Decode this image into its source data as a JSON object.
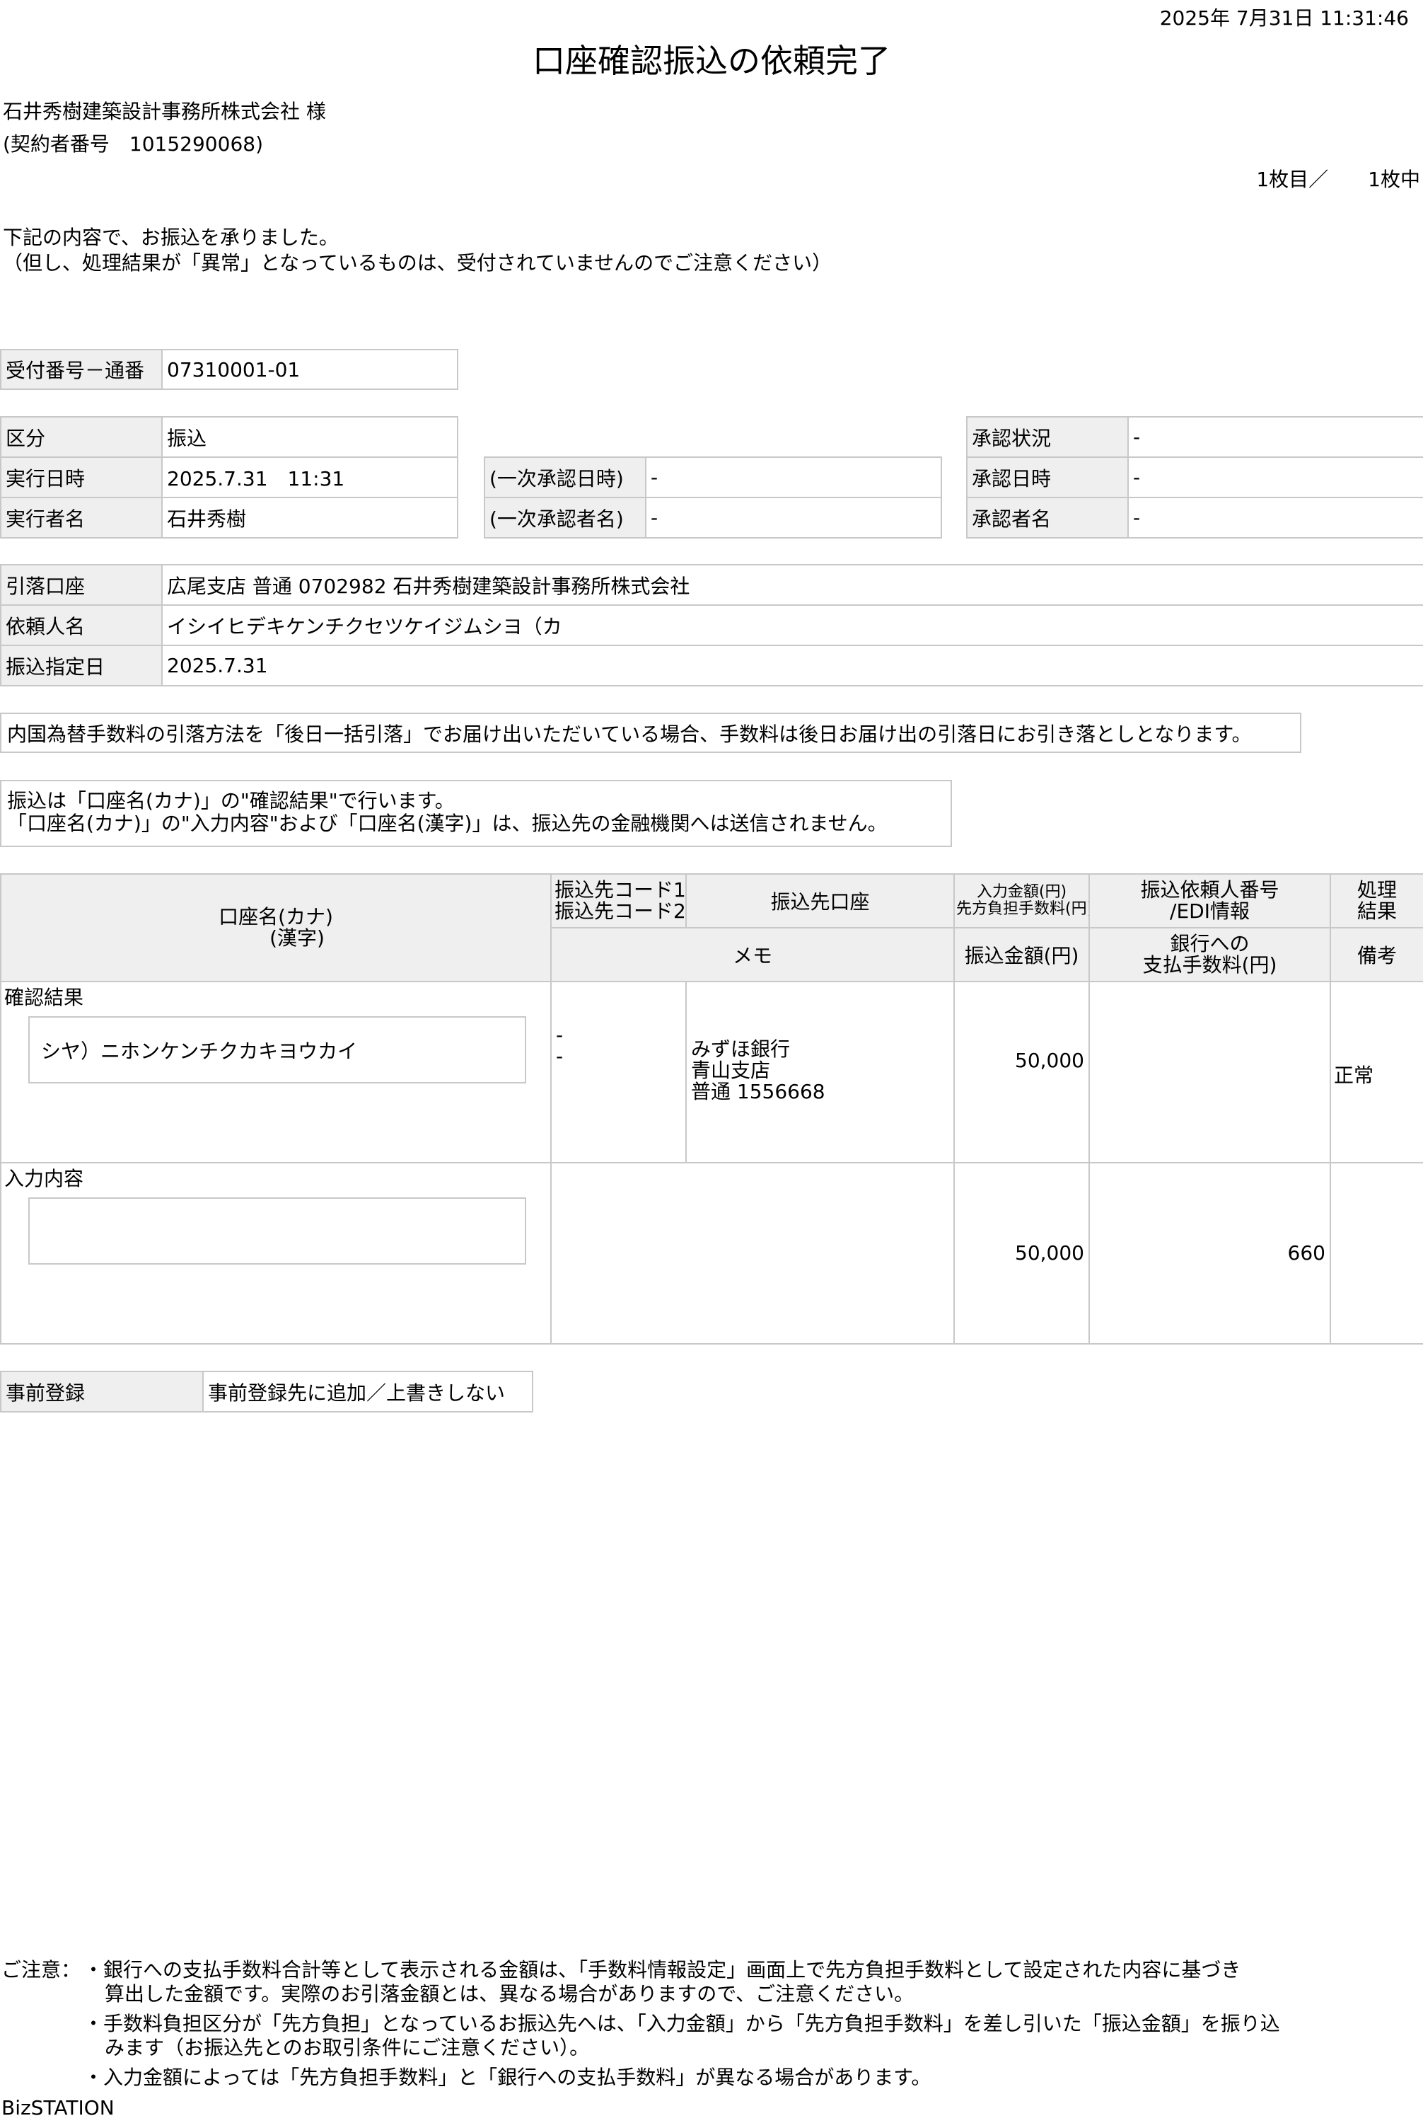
{
  "timestamp": "2025年 7月31日 11:31:46",
  "title": "口座確認振込の依頼完了",
  "company": "石井秀樹建築設計事務所株式会社 様",
  "contract_no": "(契約者番号　1015290068)",
  "page_count": "1枚目／　　1枚中",
  "intro_line1": "下記の内容で、お振込を承りました。",
  "intro_line2": "（但し、処理結果が「異常」となっているものは、受付されていませんのでご注意ください）",
  "receipt": {
    "label": "受付番号－通番",
    "value": "07310001-01"
  },
  "exec": {
    "kubun_label": "区分",
    "kubun_value": "振込",
    "date_label": "実行日時",
    "date_value": "2025.7.31　11:31",
    "person_label": "実行者名",
    "person_value": "石井秀樹"
  },
  "first_approval": {
    "date_label": "(一次承認日時)",
    "date_value": "-",
    "person_label": "(一次承認者名)",
    "person_value": "-"
  },
  "approval": {
    "status_label": "承認状況",
    "status_value": "-",
    "date_label": "承認日時",
    "date_value": "-",
    "person_label": "承認者名",
    "person_value": "-"
  },
  "account": {
    "debit_label": "引落口座",
    "debit_value": "広尾支店 普通 0702982 石井秀樹建築設計事務所株式会社",
    "requester_label": "依頼人名",
    "requester_value": "イシイヒデキケンチクセツケイジムシヨ（カ",
    "transfer_date_label": "振込指定日",
    "transfer_date_value": "2025.7.31"
  },
  "fee_note": "内国為替手数料の引落方法を「後日一括引落」でお届け出いただいている場合、手数料は後日お届け出の引落日にお引き落としとなります。",
  "kana_note1": "振込は「口座名(カナ)」の\"確認結果\"で行います。",
  "kana_note2": "「口座名(カナ)」の\"入力内容\"および「口座名(漢字)」は、振込先の金融機関へは送信されません。",
  "detail": {
    "h_account_name_kana": "口座名(カナ)",
    "h_account_name_kanji": "(漢字)",
    "h_code1": "振込先コード1",
    "h_code2": "振込先コード2",
    "h_dest_account": "振込先口座",
    "h_input_amount": "入力金額(円)",
    "h_prepaid_fee": "先方負担手数料(円)",
    "h_requester_no": "振込依頼人番号",
    "h_edi": "/EDI情報",
    "h_result1": "処理",
    "h_result2": "結果",
    "h_memo": "メモ",
    "h_transfer_amount": "振込金額(円)",
    "h_bank_fee1": "銀行への",
    "h_bank_fee2": "支払手数料(円)",
    "h_remarks": "備考",
    "confirm_label": "確認結果",
    "confirm_name": "シヤ）ニホンケンチクカキヨウカイ",
    "code1": "-",
    "code2": "-",
    "bank": "みずほ銀行",
    "branch": "青山支店",
    "acct": "普通 1556668",
    "confirm_amount": "50,000",
    "result": "正常",
    "input_label": "入力内容",
    "input_amount": "50,000",
    "bank_fee": "660"
  },
  "pre_reg": {
    "label": "事前登録",
    "value": "事前登録先に追加／上書きしない"
  },
  "notes": {
    "prefix": "ご注意：",
    "n1a": "・銀行への支払手数料合計等として表示される金額は、「手数料情報設定」画面上で先方負担手数料として設定された内容に基づき",
    "n1b": "算出した金額です。実際のお引落金額とは、異なる場合がありますので、ご注意ください。",
    "n2a": "・手数料負担区分が「先方負担」となっているお振込先へは、「入力金額」から「先方負担手数料」を差し引いた「振込金額」を振り込",
    "n2b": "みます（お振込先とのお取引条件にご注意ください）。",
    "n3": "・入力金額によっては「先方負担手数料」と「銀行への支払手数料」が異なる場合があります。"
  },
  "footer": "BizSTATION"
}
